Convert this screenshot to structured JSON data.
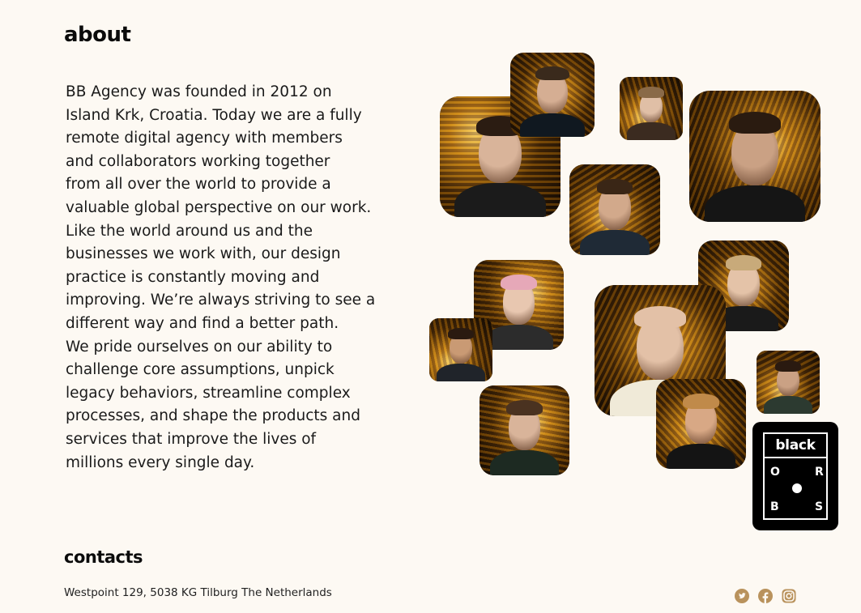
{
  "about": {
    "heading": "about",
    "lines": [
      "BB Agency was founded in 2012 on",
      "Island Krk, Croatia. Today we are a fully",
      "remote digital agency with members",
      "and collaborators working together",
      "from all over the world to provide a",
      "valuable global perspective on our work.",
      "Like the world around us and the",
      "businesses we work with, our design",
      "practice is constantly moving and",
      "improving. We’re always striving to see a",
      "different way and find a better path.",
      "We pride ourselves on our ability to",
      "challenge core assumptions, unpick",
      "legacy behaviors, streamline complex",
      "processes, and shape the products and",
      "services that improve the lives of",
      "millions every single day."
    ]
  },
  "logo": {
    "word": "black",
    "letters": [
      "O",
      "R",
      "B",
      "S"
    ]
  },
  "contacts": {
    "heading": "contacts",
    "address": "Westpoint 129, 5038 KG Tilburg The Netherlands"
  },
  "social": {
    "icons": [
      "twitter-icon",
      "facebook-icon",
      "instagram-icon"
    ],
    "color": "#b9925c"
  },
  "colors": {
    "background": "#fdf9f3",
    "text": "#111111",
    "gold": "#d8a040",
    "dark": "#1c1208"
  }
}
